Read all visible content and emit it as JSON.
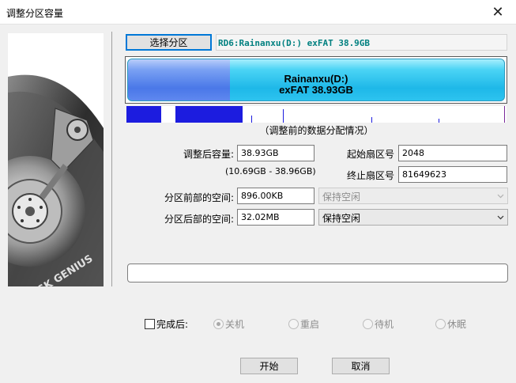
{
  "window": {
    "title": "调整分区容量",
    "close_label": "✕"
  },
  "side_image": {
    "logo_text": "DISK GENIUS"
  },
  "partition": {
    "select_button": "选择分区",
    "name_field": "RD6:Rainanxu(D:) exFAT 38.9GB",
    "bar": {
      "line1": "Rainanxu(D:)",
      "line2": "exFAT 38.93GB",
      "used_fraction": 0.27,
      "colors": {
        "used": "#4a78e8",
        "free": "#1eb8e8"
      }
    },
    "cluster_map_caption": "（调整前的数据分配情况）"
  },
  "form": {
    "new_size_label": "调整后容量:",
    "new_size_value": "38.93GB",
    "size_range": "(10.69GB - 38.96GB)",
    "start_sector_label": "起始扇区号",
    "start_sector_value": "2048",
    "end_sector_label": "终止扇区号",
    "end_sector_value": "81649623",
    "space_before_label": "分区前部的空间:",
    "space_before_value": "896.00KB",
    "space_before_option": "保持空闲",
    "space_after_label": "分区后部的空间:",
    "space_after_value": "32.02MB",
    "space_after_option": "保持空闲"
  },
  "after_done": {
    "checkbox_label": "完成后:",
    "options": [
      "关机",
      "重启",
      "待机",
      "休眠"
    ],
    "selected_index": 0
  },
  "buttons": {
    "start": "开始",
    "cancel": "取消"
  }
}
